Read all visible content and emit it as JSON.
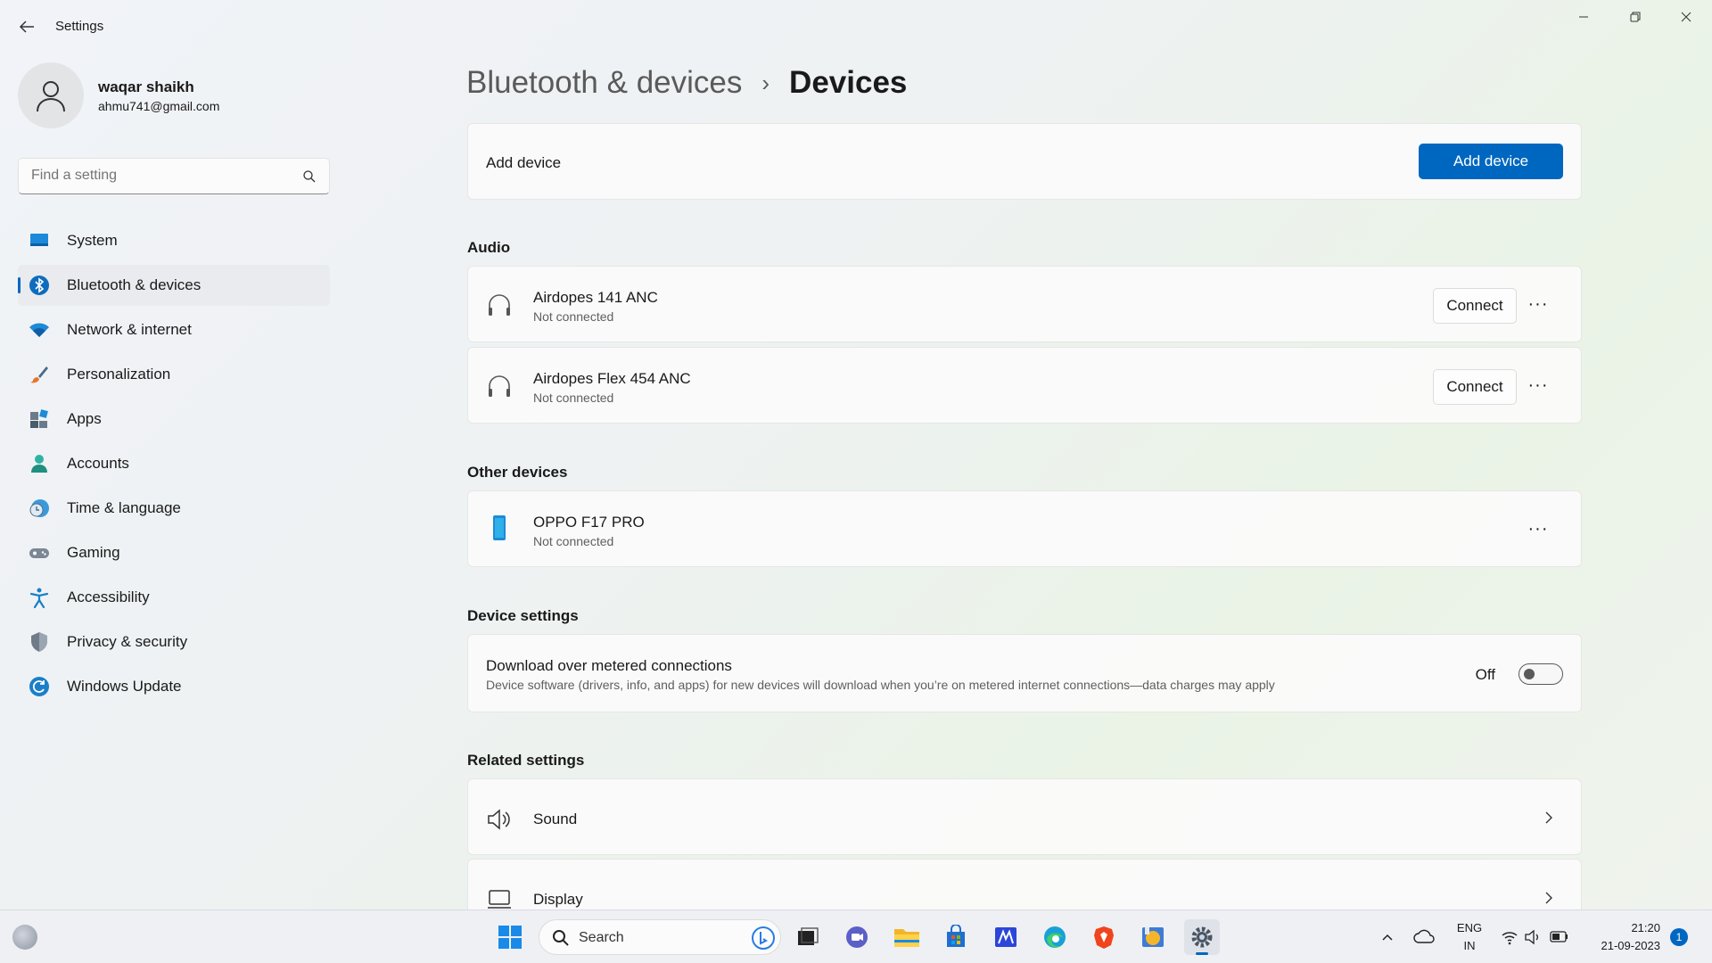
{
  "window": {
    "title": "Settings",
    "controls": [
      "minimize",
      "restore",
      "close"
    ]
  },
  "profile": {
    "name": "waqar shaikh",
    "email": "ahmu741@gmail.com"
  },
  "search": {
    "placeholder": "Find a setting"
  },
  "sidebar": {
    "items": [
      {
        "label": "System",
        "icon": "system-icon"
      },
      {
        "label": "Bluetooth & devices",
        "icon": "bluetooth-icon",
        "active": true
      },
      {
        "label": "Network & internet",
        "icon": "wifi-icon"
      },
      {
        "label": "Personalization",
        "icon": "brush-icon"
      },
      {
        "label": "Apps",
        "icon": "apps-icon"
      },
      {
        "label": "Accounts",
        "icon": "accounts-icon"
      },
      {
        "label": "Time & language",
        "icon": "clock-globe-icon"
      },
      {
        "label": "Gaming",
        "icon": "gamepad-icon"
      },
      {
        "label": "Accessibility",
        "icon": "accessibility-icon"
      },
      {
        "label": "Privacy & security",
        "icon": "shield-icon"
      },
      {
        "label": "Windows Update",
        "icon": "update-icon"
      }
    ]
  },
  "breadcrumb": {
    "parent": "Bluetooth & devices",
    "separator": "›",
    "current": "Devices"
  },
  "add_device": {
    "label": "Add device",
    "button": "Add device"
  },
  "audio": {
    "heading": "Audio",
    "devices": [
      {
        "name": "Airdopes 141 ANC",
        "status": "Not connected",
        "action": "Connect",
        "icon": "headphones-icon"
      },
      {
        "name": "Airdopes Flex 454 ANC",
        "status": "Not connected",
        "action": "Connect",
        "icon": "headphones-icon"
      }
    ]
  },
  "other_devices": {
    "heading": "Other devices",
    "devices": [
      {
        "name": "OPPO F17 PRO",
        "status": "Not connected",
        "icon": "phone-icon"
      }
    ]
  },
  "device_settings": {
    "heading": "Device settings",
    "metered": {
      "title": "Download over metered connections",
      "description": "Device software (drivers, info, and apps) for new devices will download when you’re on metered internet connections—data charges may apply",
      "state_label": "Off",
      "on": false
    }
  },
  "related_settings": {
    "heading": "Related settings",
    "items": [
      {
        "label": "Sound",
        "icon": "speaker-icon"
      },
      {
        "label": "Display",
        "icon": "laptop-icon"
      }
    ]
  },
  "taskbar": {
    "search_label": "Search",
    "language": "ENG",
    "region": "IN",
    "time": "21:20",
    "date": "21-09-2023",
    "notifications": "1"
  },
  "colors": {
    "accent": "#0067c0",
    "toggle_off": "#5a5a5a"
  }
}
